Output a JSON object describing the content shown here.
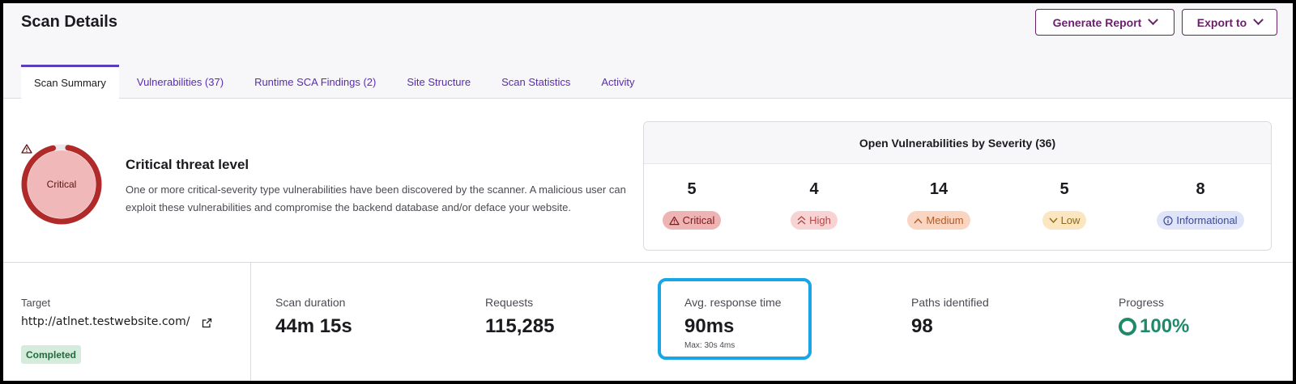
{
  "page": {
    "title": "Scan Details",
    "generate_report_label": "Generate Report",
    "export_label": "Export to"
  },
  "tabs": [
    {
      "label": "Scan Summary",
      "active": true
    },
    {
      "label": "Vulnerabilities (37)",
      "active": false
    },
    {
      "label": "Runtime SCA Findings (2)",
      "active": false
    },
    {
      "label": "Site Structure",
      "active": false
    },
    {
      "label": "Scan Statistics",
      "active": false
    },
    {
      "label": "Activity",
      "active": false
    }
  ],
  "threat": {
    "ring_label": "Critical",
    "title": "Critical threat level",
    "description": "One or more critical-severity type vulnerabilities have been discovered by the scanner. A malicious user can exploit these vulnerabilities and compromise the backend database and/or deface your website.",
    "ring_color": "#b02a2a",
    "fill_color": "#f0b8b8",
    "icon": "warning-triangle-icon"
  },
  "severity": {
    "title": "Open Vulnerabilities by Severity (36)",
    "items": [
      {
        "count": "5",
        "label": "Critical",
        "icon": "warning-triangle-icon",
        "glyph": "⚠"
      },
      {
        "count": "4",
        "label": "High",
        "icon": "double-chevron-up-icon",
        "glyph": "≈"
      },
      {
        "count": "14",
        "label": "Medium",
        "icon": "chevron-up-icon",
        "glyph": "^"
      },
      {
        "count": "5",
        "label": "Low",
        "icon": "chevron-down-icon",
        "glyph": "v"
      },
      {
        "count": "8",
        "label": "Informational",
        "icon": "info-circle-icon",
        "glyph": "ⓘ"
      }
    ]
  },
  "target": {
    "label": "Target",
    "url": "http://atlnet.testwebsite.com/",
    "status": "Completed"
  },
  "stats": {
    "duration_label": "Scan duration",
    "duration_value": "44m 15s",
    "requests_label": "Requests",
    "requests_value": "115,285",
    "response_label": "Avg. response time",
    "response_value": "90ms",
    "response_sub": "Max: 30s 4ms",
    "paths_label": "Paths identified",
    "paths_value": "98",
    "progress_label": "Progress",
    "progress_value": "100%",
    "progress_color": "#1f8a6a"
  }
}
